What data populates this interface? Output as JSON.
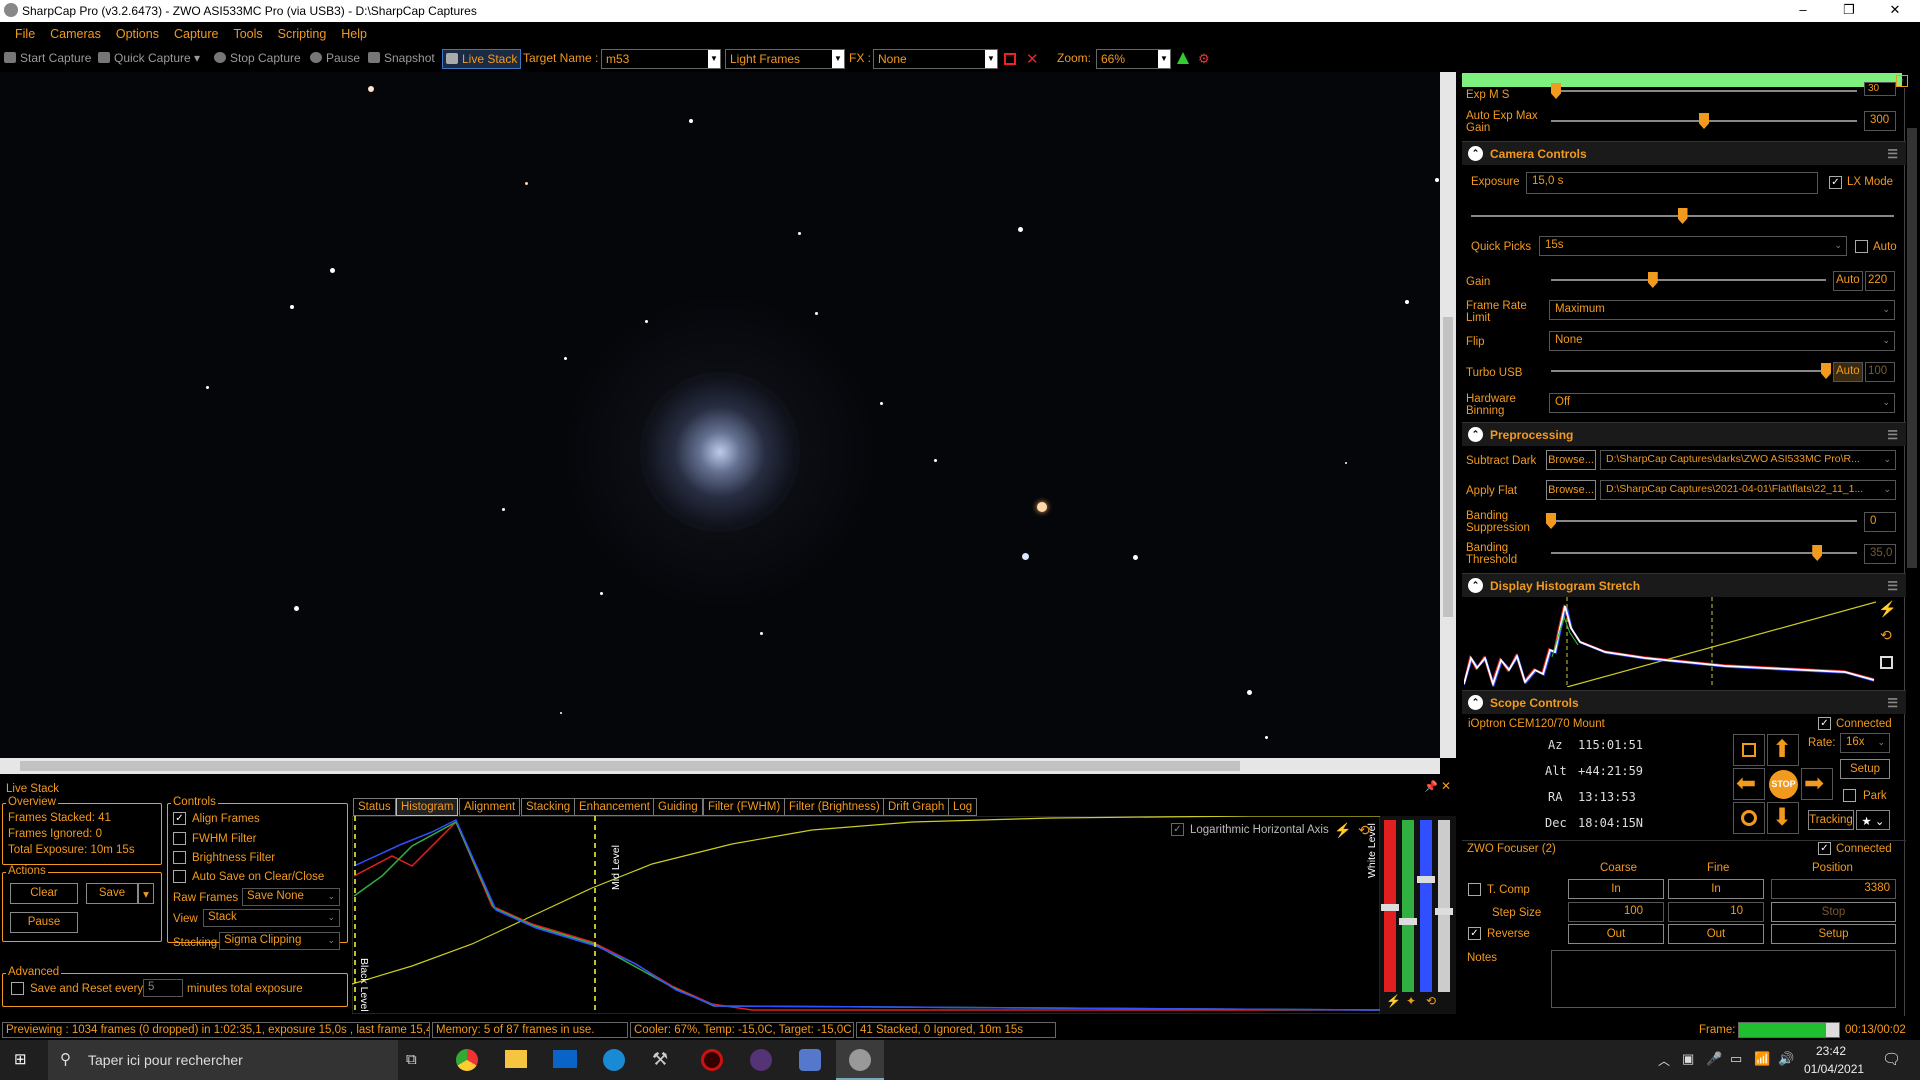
{
  "titlebar": {
    "title": "SharpCap Pro (v3.2.6473) - ZWO ASI533MC Pro (via USB3) - D:\\SharpCap Captures",
    "min": "–",
    "max": "❐",
    "close": "✕"
  },
  "menu": [
    "File",
    "Cameras",
    "Options",
    "Capture",
    "Tools",
    "Scripting",
    "Help"
  ],
  "toolbar": {
    "start_capture": "Start Capture",
    "quick_capture": "Quick Capture",
    "stop_capture": "Stop Capture",
    "pause": "Pause",
    "snapshot": "Snapshot",
    "live_stack": "Live Stack",
    "target_name_label": "Target Name :",
    "target_name": "m53",
    "frame_type": "Light Frames",
    "fx_label": "FX :",
    "fx": "None",
    "zoom_label": "Zoom:",
    "zoom": "66%"
  },
  "camera_top": {
    "exp_ms_label": "Exp M S",
    "exp_ms_value": "30",
    "auto_exp_max_gain_label": "Auto Exp Max Gain",
    "auto_exp_max_gain_value": "300",
    "auto_exp_max_gain_level": 0.5
  },
  "camera_controls": {
    "title": "Camera Controls",
    "exposure_label": "Exposure",
    "exposure_value": "15,0 s",
    "lx_mode": "LX Mode",
    "lx_mode_checked": true,
    "exposure_level": 0.5,
    "quick_picks_label": "Quick Picks",
    "quick_picks_value": "15s",
    "quick_picks_auto": "Auto",
    "gain_label": "Gain",
    "gain_auto": "Auto",
    "gain_value": "220",
    "gain_level": 0.37,
    "frame_rate_label": "Frame Rate Limit",
    "frame_rate_value": "Maximum",
    "flip_label": "Flip",
    "flip_value": "None",
    "turbo_usb_label": "Turbo USB",
    "turbo_usb_auto": "Auto",
    "turbo_usb_value": "100",
    "turbo_usb_level": 1.0,
    "hw_binning_label": "Hardware Binning",
    "hw_binning_value": "Off"
  },
  "preprocessing": {
    "title": "Preprocessing",
    "subtract_dark_label": "Subtract Dark",
    "browse": "Browse...",
    "subtract_dark_path": "D:\\SharpCap Captures\\darks\\ZWO ASI533MC Pro\\R...",
    "apply_flat_label": "Apply Flat",
    "apply_flat_path": "D:\\SharpCap Captures\\2021-04-01\\Flat\\flats\\22_11_1...",
    "banding_supp_label": "Banding Suppression",
    "banding_supp_value": "0",
    "banding_supp_level": 0.0,
    "banding_thr_label": "Banding Threshold",
    "banding_thr_value": "35,0",
    "banding_thr_level": 0.87
  },
  "histogram_stretch": {
    "title": "Display Histogram Stretch"
  },
  "scope": {
    "title": "Scope Controls",
    "mount": "iOptron CEM120/70 Mount",
    "connected": "Connected",
    "az_label": "Az",
    "az": "115:01:51",
    "alt_label": "Alt",
    "alt": "+44:21:59",
    "ra_label": "RA",
    "ra": "13:13:53",
    "dec_label": "Dec",
    "dec": "18:04:15N",
    "rate_label": "Rate:",
    "rate": "16x",
    "setup": "Setup",
    "park": "Park",
    "tracking": "Tracking",
    "stop": "STOP"
  },
  "focuser": {
    "title": "ZWO Focuser (2)",
    "connected": "Connected",
    "coarse": "Coarse",
    "fine": "Fine",
    "position": "Position",
    "tcomp": "T. Comp",
    "in": "In",
    "position_value": "3380",
    "step_size_label": "Step Size",
    "coarse_step": "100",
    "fine_step": "10",
    "stop": "Stop",
    "reverse": "Reverse",
    "out": "Out",
    "setup": "Setup",
    "notes_label": "Notes"
  },
  "live_stack": {
    "title": "Live Stack",
    "overview_title": "Overview",
    "frames_stacked": "Frames Stacked:  41",
    "frames_ignored": "Frames Ignored:   0",
    "total_exposure": "Total Exposure:   10m 15s",
    "actions_title": "Actions",
    "clear": "Clear",
    "save": "Save",
    "pause": "Pause",
    "controls_title": "Controls",
    "align_frames": "Align Frames",
    "fwhm_filter": "FWHM Filter",
    "brightness_filter": "Brightness Filter",
    "auto_save": "Auto Save on Clear/Close",
    "raw_frames_label": "Raw Frames",
    "raw_frames_value": "Save None",
    "view_label": "View",
    "view_value": "Stack",
    "stacking_label": "Stacking",
    "stacking_value": "Sigma Clipping",
    "advanced_title": "Advanced",
    "save_reset_label": "Save and Reset every",
    "save_reset_value": "5",
    "save_reset_suffix": "minutes total exposure",
    "tabs": [
      "Status",
      "Histogram",
      "Alignment",
      "Stacking",
      "Enhancement",
      "Guiding",
      "Filter (FWHM)",
      "Filter (Brightness)",
      "Drift Graph",
      "Log"
    ],
    "log_axis": "Logarithmic Horizontal Axis",
    "black_level": "Black Level",
    "mid_level": "Mid Level",
    "white_level": "White Level"
  },
  "status": {
    "previewing": "Previewing : 1034 frames (0 dropped) in 1:02:35,1, exposure 15,0s , last frame 15,4",
    "memory": "Memory: 5 of 87 frames in use.",
    "cooler": "Cooler: 67%, Temp: -15,0C, Target: -15,0C",
    "stacked": "41 Stacked, 0 Ignored, 10m 15s",
    "frame_label": "Frame:",
    "frame_time": "00:13/00:02",
    "frame_progress": 0.87
  },
  "taskbar": {
    "search": "Taper ici pour rechercher",
    "time": "23:42",
    "date": "01/04/2021"
  },
  "colors": {
    "accent": "#f29a1e",
    "background": "#000000"
  }
}
